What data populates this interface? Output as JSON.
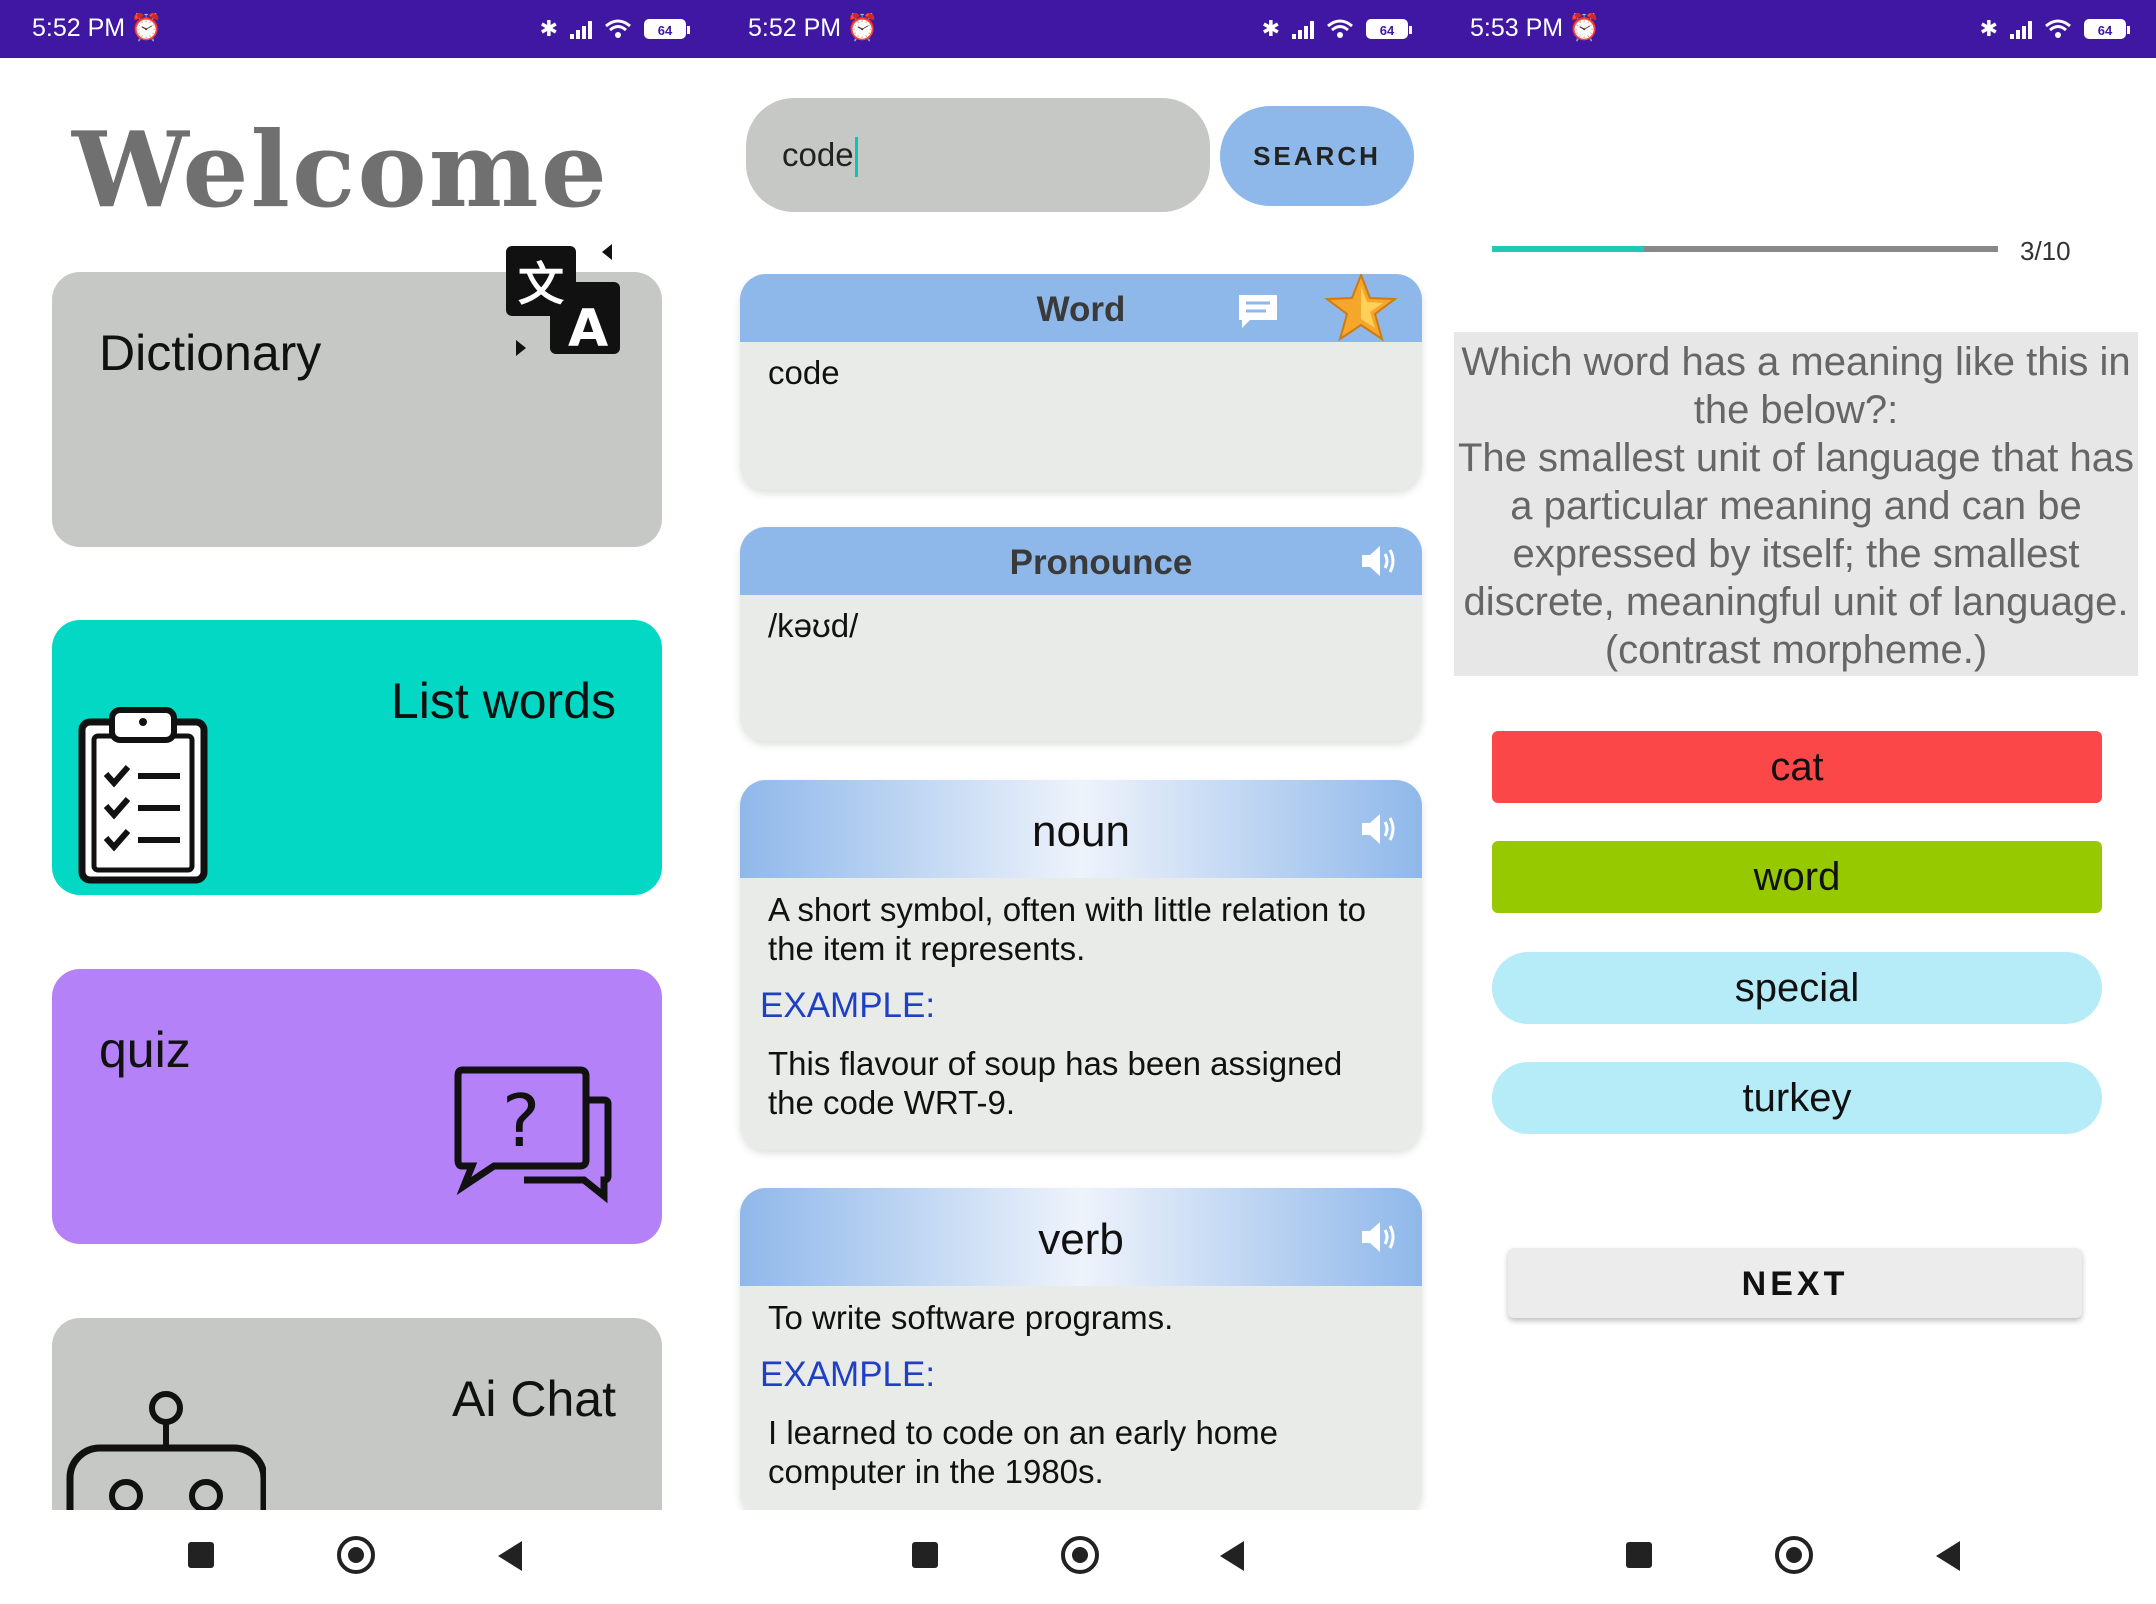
{
  "status": {
    "screen1_time": "5:52 PM",
    "screen2_time": "5:52 PM",
    "screen3_time": "5:53 PM",
    "battery": "64"
  },
  "home": {
    "title": "Welcome",
    "cards": [
      {
        "label": "Dictionary",
        "icon": "translate-icon",
        "color": "#c6c8c5"
      },
      {
        "label": "List words",
        "icon": "clipboard-checklist-icon",
        "color": "#03d8c5"
      },
      {
        "label": "quiz",
        "icon": "question-chat-icon",
        "color": "#b581f9"
      },
      {
        "label": "Ai Chat",
        "icon": "robot-icon",
        "color": "#c6c8c5"
      }
    ]
  },
  "dictionary": {
    "search_value": "code",
    "search_button": "SEARCH",
    "word_header": "Word",
    "word_value": "code",
    "pronounce_header": "Pronounce",
    "pronounce_value": "/kəʊd/",
    "definitions": [
      {
        "pos": "noun",
        "definition": "A short symbol, often with little relation to the item it represents.",
        "example_label": "EXAMPLE:",
        "example": "This flavour of soup has been assigned the code WRT-9."
      },
      {
        "pos": "verb",
        "definition": "To write software programs.",
        "example_label": "EXAMPLE:",
        "example": "I learned to code on an early home computer in the 1980s."
      }
    ]
  },
  "quiz": {
    "progress_text": "3/10",
    "progress_fraction": 0.3,
    "question": "Which word has a meaning like this in the below?:\nThe smallest unit of language that has a particular meaning and can be expressed by itself; the smallest discrete, meaningful unit of language. (contrast morpheme.)",
    "options": [
      {
        "label": "cat",
        "state": "wrong"
      },
      {
        "label": "word",
        "state": "correct"
      },
      {
        "label": "special",
        "state": "neutral"
      },
      {
        "label": "turkey",
        "state": "neutral"
      }
    ],
    "next_button": "NEXT"
  },
  "colors": {
    "status_bar": "#3f17a3",
    "accent_blue": "#8fb8ea",
    "example_blue": "#1f3fc4",
    "wrong": "#fb4747",
    "correct": "#96c900",
    "neutral": "#b5ecf7"
  }
}
